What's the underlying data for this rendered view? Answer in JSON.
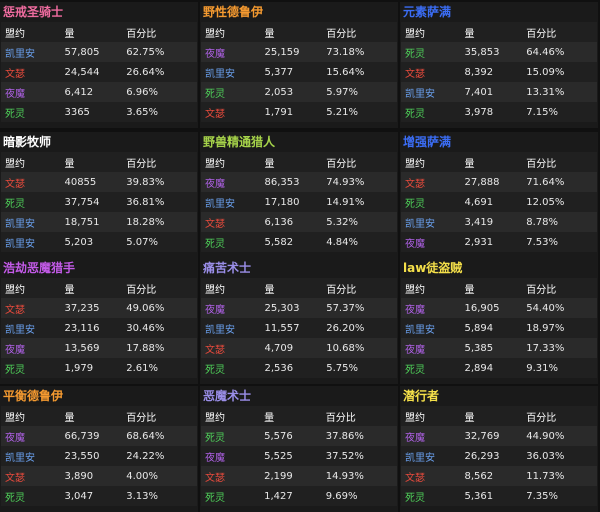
{
  "colors": {
    "夜魔": "#b061e8",
    "文瑟": "#e64a3c",
    "死灵": "#4fd35a",
    "凯里安": "#6aa0ee"
  },
  "headers": {
    "covenant": "盟约",
    "count": "量",
    "percent": "百分比"
  },
  "panels": [
    {
      "title": "惩戒圣骑士",
      "title_color": "#f06ca0",
      "rows": [
        [
          "凯里安",
          "57,805",
          "62.75%"
        ],
        [
          "文瑟",
          "24,544",
          "26.64%"
        ],
        [
          "夜魔",
          "6,412",
          "6.96%"
        ],
        [
          "死灵",
          "3365",
          "3.65%"
        ]
      ]
    },
    {
      "title": "野性德鲁伊",
      "title_color": "#f59a30",
      "rows": [
        [
          "夜魔",
          "25,159",
          "73.18%"
        ],
        [
          "凯里安",
          "5,377",
          "15.64%"
        ],
        [
          "死灵",
          "2,053",
          "5.97%"
        ],
        [
          "文瑟",
          "1,791",
          "5.21%"
        ]
      ]
    },
    {
      "title": "元素萨满",
      "title_color": "#3b6df5",
      "rows": [
        [
          "死灵",
          "35,853",
          "64.46%"
        ],
        [
          "文瑟",
          "8,392",
          "15.09%"
        ],
        [
          "凯里安",
          "7,401",
          "13.31%"
        ],
        [
          "死灵",
          "3,978",
          "7.15%"
        ]
      ]
    },
    {
      "title": "暗影牧师",
      "title_color": "#ffffff",
      "rows": [
        [
          "文瑟",
          "40855",
          "39.83%"
        ],
        [
          "死灵",
          "37,754",
          "36.81%"
        ],
        [
          "凯里安",
          "18,751",
          "18.28%"
        ],
        [
          "凯里安",
          "5,203",
          "5.07%"
        ]
      ]
    },
    {
      "title": "野兽精通猎人",
      "title_color": "#a6d34a",
      "rows": [
        [
          "夜魔",
          "86,353",
          "74.93%"
        ],
        [
          "凯里安",
          "17,180",
          "14.91%"
        ],
        [
          "文瑟",
          "6,136",
          "5.32%"
        ],
        [
          "死灵",
          "5,582",
          "4.84%"
        ]
      ]
    },
    {
      "title": "增强萨满",
      "title_color": "#3b6df5",
      "rows": [
        [
          "文瑟",
          "27,888",
          "71.64%"
        ],
        [
          "死灵",
          "4,691",
          "12.05%"
        ],
        [
          "凯里安",
          "3,419",
          "8.78%"
        ],
        [
          "夜魔",
          "2,931",
          "7.53%"
        ]
      ]
    },
    {
      "title": "浩劫恶魔猎手",
      "title_color": "#c35ae8",
      "rows": [
        [
          "文瑟",
          "37,235",
          "49.06%"
        ],
        [
          "凯里安",
          "23,116",
          "30.46%"
        ],
        [
          "夜魔",
          "13,569",
          "17.88%"
        ],
        [
          "死灵",
          "1,979",
          "2.61%"
        ]
      ]
    },
    {
      "title": "痛苦术士",
      "title_color": "#9a8ee8",
      "rows": [
        [
          "夜魔",
          "25,303",
          "57.37%"
        ],
        [
          "凯里安",
          "11,557",
          "26.20%"
        ],
        [
          "文瑟",
          "4,709",
          "10.68%"
        ],
        [
          "死灵",
          "2,536",
          "5.75%"
        ]
      ]
    },
    {
      "title": "law徒盗贼",
      "title_color": "#f5e04a",
      "rows": [
        [
          "夜魔",
          "16,905",
          "54.40%"
        ],
        [
          "凯里安",
          "5,894",
          "18.97%"
        ],
        [
          "夜魔",
          "5,385",
          "17.33%"
        ],
        [
          "死灵",
          "2,894",
          "9.31%"
        ]
      ]
    },
    {
      "title": "平衡德鲁伊",
      "title_color": "#f59a30",
      "rows": [
        [
          "夜魔",
          "66,739",
          "68.64%"
        ],
        [
          "凯里安",
          "23,550",
          "24.22%"
        ],
        [
          "文瑟",
          "3,890",
          "4.00%"
        ],
        [
          "死灵",
          "3,047",
          "3.13%"
        ]
      ]
    },
    {
      "title": "恶魔术士",
      "title_color": "#9a8ee8",
      "rows": [
        [
          "死灵",
          "5,576",
          "37.86%"
        ],
        [
          "夜魔",
          "5,525",
          "37.52%"
        ],
        [
          "文瑟",
          "2,199",
          "14.93%"
        ],
        [
          "死灵",
          "1,427",
          "9.69%"
        ]
      ]
    },
    {
      "title": "潜行者",
      "title_color": "#f5e04a",
      "rows": [
        [
          "夜魔",
          "32,769",
          "44.90%"
        ],
        [
          "凯里安",
          "26,293",
          "36.03%"
        ],
        [
          "文瑟",
          "8,562",
          "11.73%"
        ],
        [
          "死灵",
          "5,361",
          "7.35%"
        ]
      ]
    }
  ]
}
